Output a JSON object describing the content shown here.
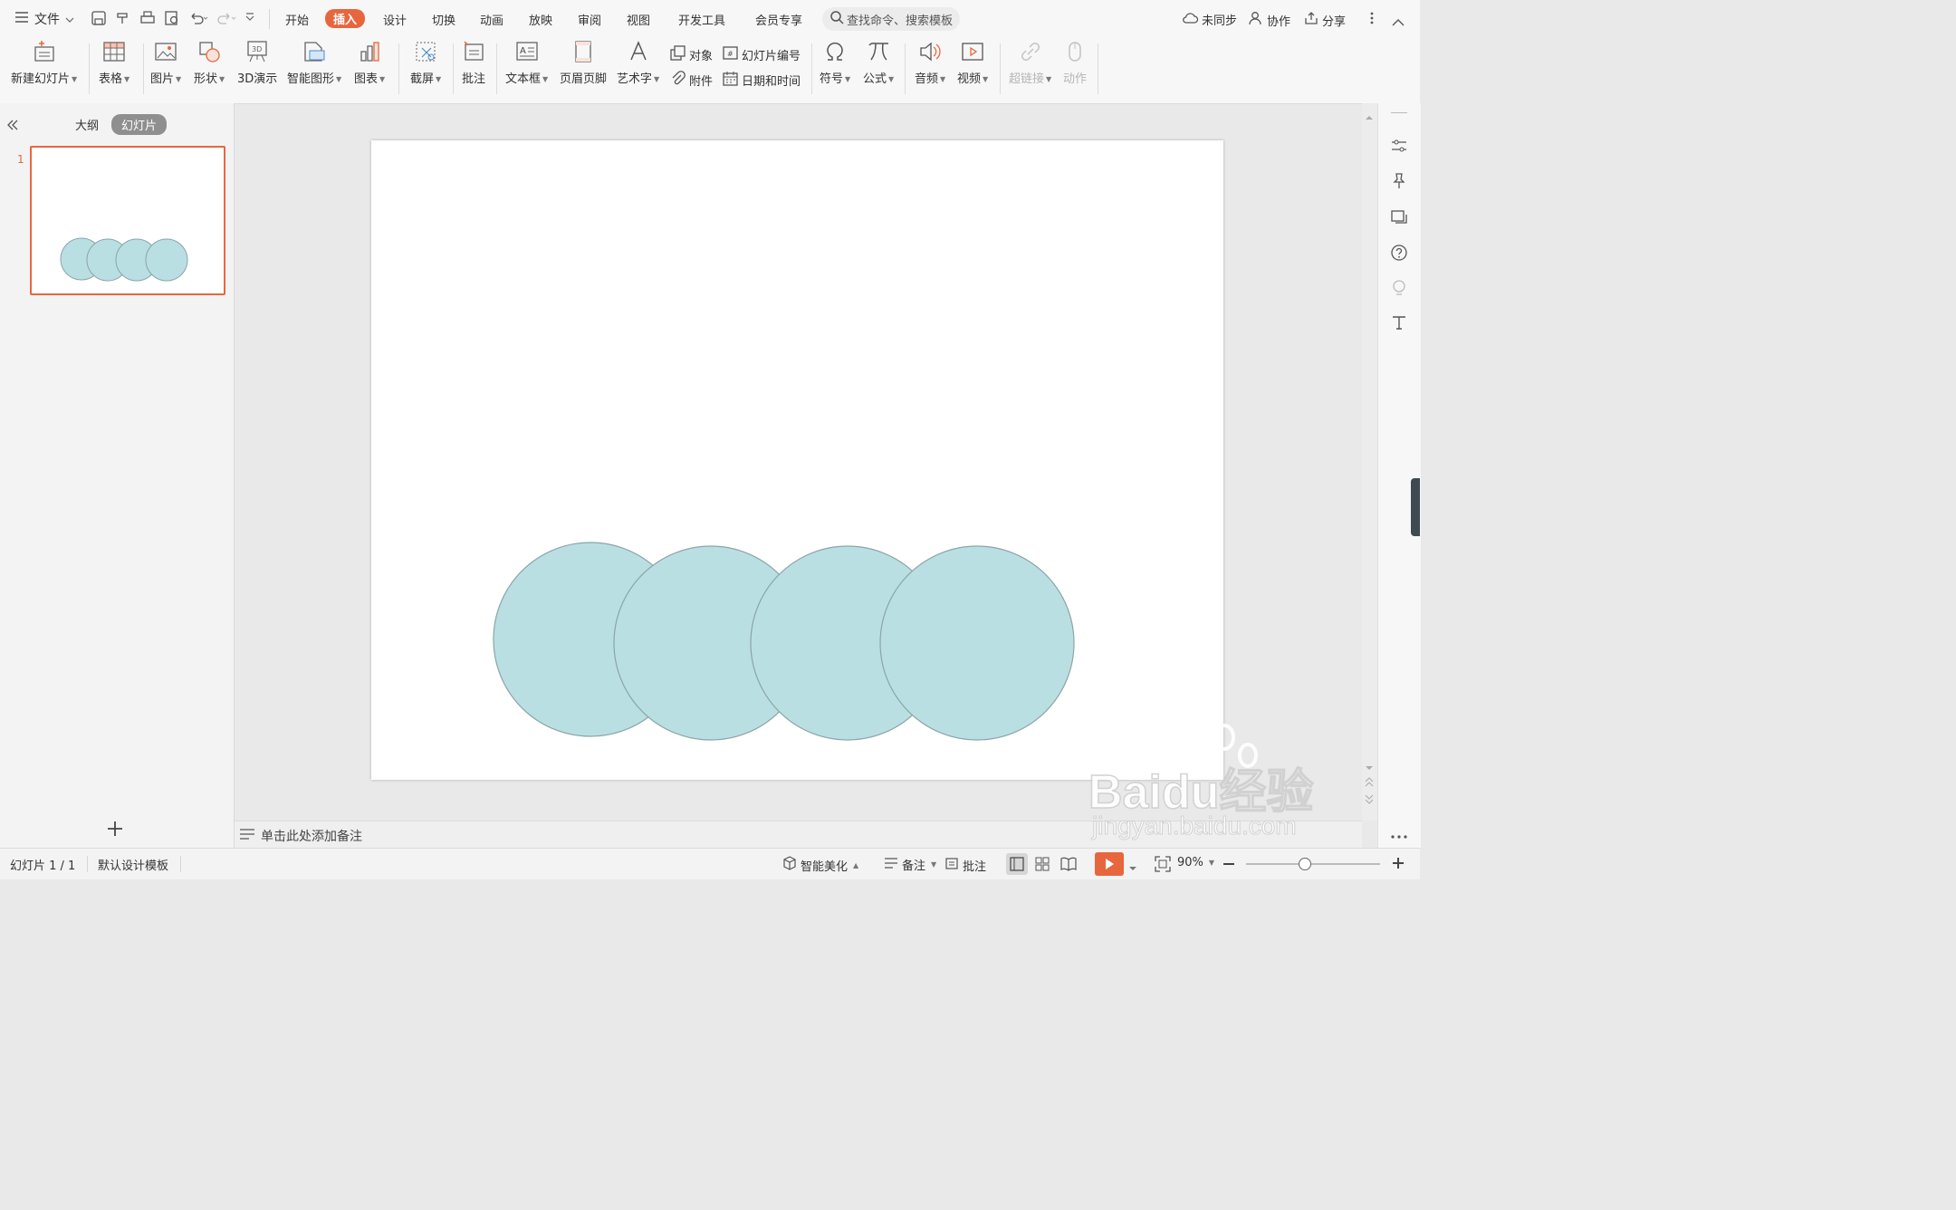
{
  "menubar": {
    "file_label": "文件",
    "tabs": [
      "开始",
      "插入",
      "设计",
      "切换",
      "动画",
      "放映",
      "审阅",
      "视图",
      "开发工具",
      "会员专享"
    ],
    "active_tab": "插入",
    "search_placeholder": "查找命令、搜索模板",
    "sync_label": "未同步",
    "collab_label": "协作",
    "share_label": "分享"
  },
  "ribbon": {
    "new_slide": "新建幻灯片",
    "table": "表格",
    "picture": "图片",
    "shape": "形状",
    "demo3d": "3D演示",
    "smartart": "智能图形",
    "chart": "图表",
    "screenshot": "截屏",
    "comment": "批注",
    "textbox": "文本框",
    "header_footer": "页眉页脚",
    "wordart": "艺术字",
    "object": "对象",
    "attachment": "附件",
    "slide_number": "幻灯片编号",
    "date_time": "日期和时间",
    "symbol": "符号",
    "formula": "公式",
    "audio": "音频",
    "video": "视频",
    "hyperlink": "超链接",
    "action": "动作"
  },
  "left_panel": {
    "outline_tab": "大纲",
    "slides_tab": "幻灯片",
    "slide_index": "1"
  },
  "notes_placeholder": "单击此处添加备注",
  "statusbar": {
    "slide_counter": "幻灯片 1 / 1",
    "template": "默认设计模板",
    "beautify": "智能美化",
    "notes": "备注",
    "comments": "批注",
    "zoom": "90%"
  },
  "watermark": {
    "brand": "Baidu经验",
    "url": "jingyan.baidu.com"
  },
  "colors": {
    "accent": "#e8663e",
    "circle_fill": "#badfe2",
    "circle_stroke": "#8aa5a8"
  }
}
